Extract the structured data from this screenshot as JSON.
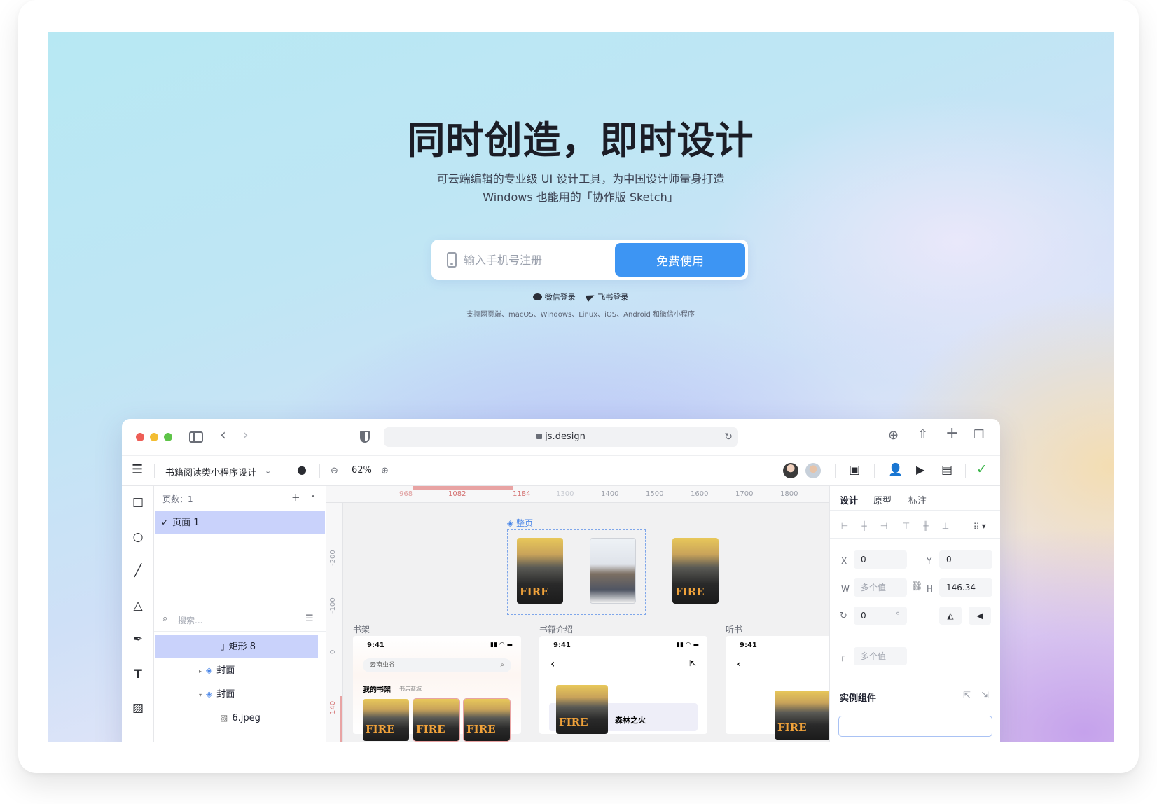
{
  "hero": {
    "headline": "同时创造，即时设计",
    "subtitle_1": "可云端编辑的专业级 UI 设计工具，为中国设计师量身打造",
    "subtitle_2": "Windows 也能用的「协作版 Sketch」",
    "signup": {
      "phone_placeholder": "输入手机号注册",
      "cta_label": "免费使用"
    },
    "wechat_login": "微信登录",
    "feishu_login": "飞书登录",
    "platforms": "支持网页端、macOS、Windows、Linux、iOS、Android 和微信小程序"
  },
  "browser": {
    "url": "js.design",
    "icons": [
      "sidebar-icon",
      "back-icon",
      "forward-icon",
      "shield-icon",
      "lock-icon",
      "reload-icon",
      "download-icon",
      "share-icon",
      "new-tab-icon",
      "tabs-icon"
    ]
  },
  "app_toolbar": {
    "file_name": "书籍阅读类小程序设计",
    "zoom": "62%"
  },
  "layers_panel": {
    "pages_header": "页数：1",
    "pages": [
      {
        "label": "页面 1",
        "checked": true
      }
    ],
    "search_placeholder": "搜索...",
    "rows": [
      {
        "label": "矩形 8",
        "selected": true
      },
      {
        "label": "封面",
        "expanded": false
      },
      {
        "label": "封面",
        "expanded": true
      },
      {
        "label": "6.jpeg"
      }
    ]
  },
  "canvas": {
    "ruler_ticks": [
      "968",
      "1082",
      "1184",
      "1300",
      "1400",
      "1500",
      "1600",
      "1700",
      "1800"
    ],
    "vruler_ticks": [
      "-200",
      "-100",
      "0",
      "140"
    ],
    "frame_label": "整页",
    "artboards": [
      {
        "label": "书架",
        "time": "9:41",
        "search_text": "云南虫谷",
        "tab_active": "我的书架",
        "tab_other": "书店商城"
      },
      {
        "label": "书籍介绍",
        "time": "9:41",
        "book_title": "森林之火"
      },
      {
        "label": "听书",
        "time": "9:41"
      }
    ]
  },
  "props_panel": {
    "tabs": [
      "设计",
      "原型",
      "标注"
    ],
    "x_label": "X",
    "x_value": "0",
    "y_label": "Y",
    "y_value": "0",
    "w_label": "W",
    "w_value": "多个值",
    "h_label": "H",
    "h_value": "146.34",
    "rotation_value": "0",
    "rotation_unit": "°",
    "radius_value": "多个值",
    "component_header": "实例组件"
  },
  "colors": {
    "accent": "#3d95f3",
    "selection": "#c9d2fb",
    "frame": "#4a86e8",
    "ruler_highlight": "#e8a3a3"
  }
}
